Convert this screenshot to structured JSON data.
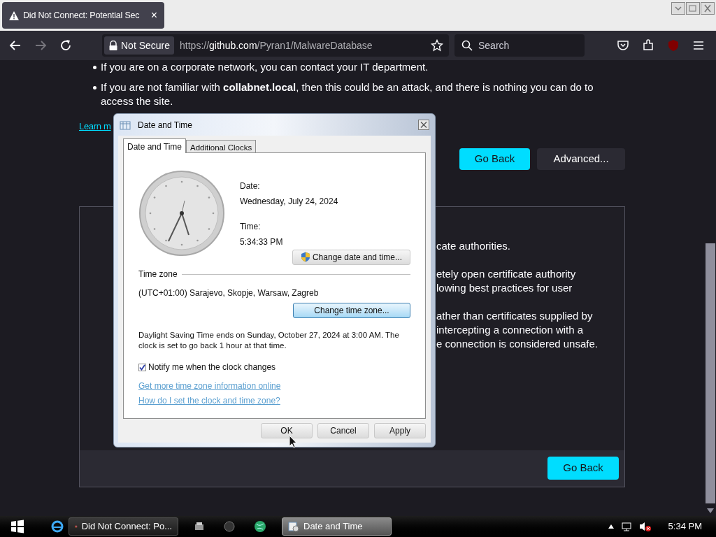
{
  "browser": {
    "tab": {
      "title": "Did Not Connect: Potential Sec",
      "close": "×"
    },
    "url_bar": {
      "security": "Not Secure",
      "prefix": "https://",
      "host": "github.com",
      "path": "/Pyran1/MalwareDatabase"
    },
    "search": {
      "placeholder": "Search"
    }
  },
  "page": {
    "bullets": [
      "If you are on a corporate network, you can contact your IT department.",
      "If you are not familiar with **collabnet.local**, then this could be an attack, and there is nothing you can do to access the site."
    ],
    "learn_more": "Learn m",
    "buttons": [
      {
        "label": "Go Back",
        "kind": "primary"
      },
      {
        "label": "Advanced...",
        "kind": "secondary"
      }
    ],
    "advanced_panel": {
      "paragraphs": [
        [
          "cate authorities."
        ],
        [
          "etely open certificate authority",
          "lowing best practices for user"
        ],
        [
          "ather than certificates supplied by",
          "intercepting a connection with a",
          "e connection is considered unsafe."
        ]
      ],
      "button": "Go Back"
    }
  },
  "dialog": {
    "title": "Date and Time",
    "tabs": [
      {
        "label": "Date and Time",
        "selected": true
      },
      {
        "label": "Additional Clocks",
        "selected": false
      }
    ],
    "date_label": "Date:",
    "date": "Wednesday, July 24, 2024",
    "time_label": "Time:",
    "time": "5:34:33 PM",
    "change_date_button": "Change date and time...",
    "time_zone_heading": "Time zone",
    "time_zone": "(UTC+01:00) Sarajevo, Skopje, Warsaw, Zagreb",
    "change_zone_button": "Change time zone...",
    "dst_note": "Daylight Saving Time ends on Sunday, October 27, 2024 at 3:00 AM. The clock is set to go back 1 hour at that time.",
    "notify": {
      "label": "Notify me when the clock changes",
      "checked": true
    },
    "links": [
      "Get more time zone information online",
      "How do I set the clock and time zone?"
    ],
    "buttons": [
      {
        "label": "OK",
        "default": false
      },
      {
        "label": "Cancel",
        "default": false
      },
      {
        "label": "Apply",
        "default": false
      }
    ]
  },
  "taskbar": {
    "tasks": [
      {
        "label": "Did Not Connect: Po...",
        "kind": "firefox",
        "selected": false
      },
      {
        "label": "Date and Time",
        "kind": "clock",
        "selected": true
      }
    ],
    "clock": "5:34 PM"
  }
}
